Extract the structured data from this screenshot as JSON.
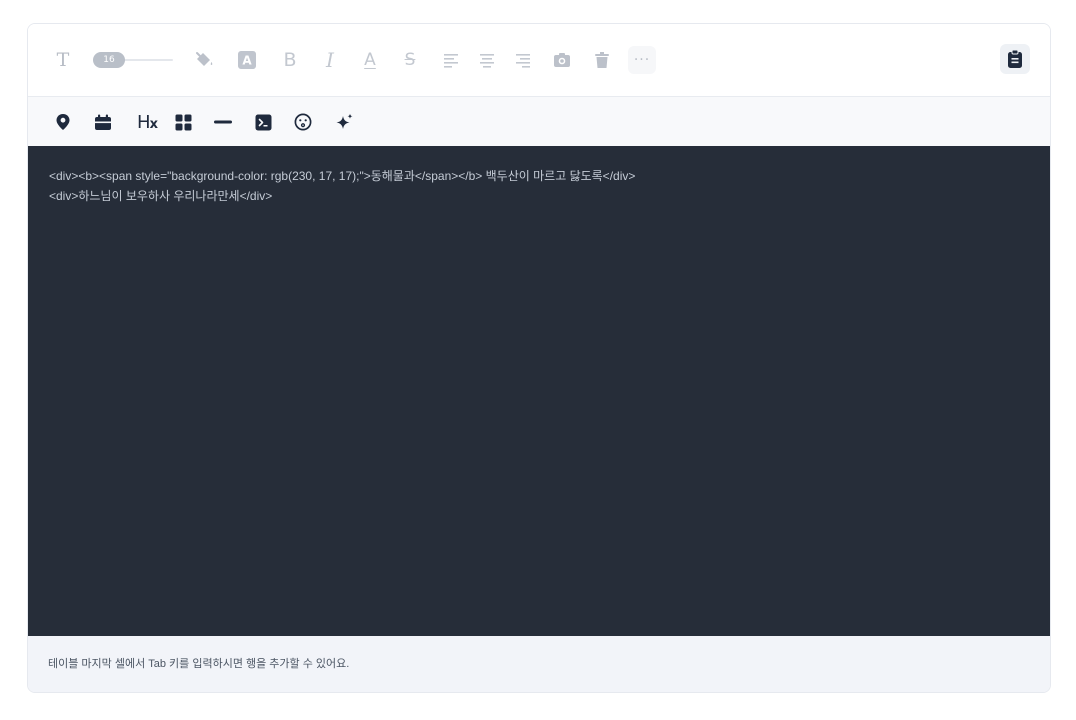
{
  "toolbar": {
    "font_size": "16",
    "more_label": "···"
  },
  "insert_toolbar": {
    "heading_label": "H",
    "heading_sub": "x"
  },
  "code": {
    "lines": [
      "<div><b><span style=\"background-color: rgb(230, 17, 17);\">동해물과</span></b> 백두산이 마르고 닳도록</div>",
      "<div>하느님이 보우하사 우리나라만세</div>"
    ]
  },
  "footer": {
    "hint": "테이블 마지막 셀에서 Tab 키를 입력하시면 행을 추가할 수 있어요."
  }
}
